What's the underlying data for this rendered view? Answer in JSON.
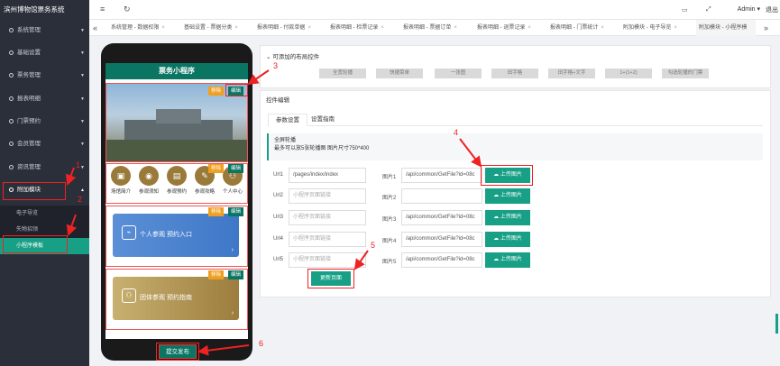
{
  "app": {
    "title": "滨州博物馆票务系统"
  },
  "sidebar": {
    "items": [
      {
        "label": "系统管理",
        "caret": "▼"
      },
      {
        "label": "基础设置",
        "caret": "▼"
      },
      {
        "label": "票务管理",
        "caret": "▼"
      },
      {
        "label": "报表明细",
        "caret": "▼"
      },
      {
        "label": "门票预约",
        "caret": "▼"
      },
      {
        "label": "会员管理",
        "caret": "▼"
      },
      {
        "label": "资讯管理",
        "caret": "▼"
      },
      {
        "label": "附加模块",
        "caret": "▲"
      }
    ],
    "subitems": [
      {
        "label": "电子导览"
      },
      {
        "label": "失物招领"
      },
      {
        "label": "小程序模板"
      }
    ]
  },
  "topbar": {
    "menu_icon": "≡",
    "refresh_icon": "↻",
    "user": "Admin",
    "user_caret": "▾",
    "logout": "退出",
    "icons": [
      "chat-icon",
      "fullscreen-icon"
    ]
  },
  "tabs": [
    {
      "label": "系统管理 - 数据权限"
    },
    {
      "label": "基础设置 - 票据分类"
    },
    {
      "label": "报表明细 - 付款单据"
    },
    {
      "label": "报表明细 - 检票记录"
    },
    {
      "label": "报表明细 - 票据订单"
    },
    {
      "label": "报表明细 - 退票记录"
    },
    {
      "label": "报表明细 - 门票统计"
    },
    {
      "label": "附加模块 - 电子导览"
    },
    {
      "label": "附加模块 - 小程序模"
    }
  ],
  "phone": {
    "title": "票务小程序",
    "remove_label": "移除",
    "edit_label": "编辑",
    "quick_items": [
      {
        "label": "场馆简介",
        "icon": "▣"
      },
      {
        "label": "参观须知",
        "icon": "◉"
      },
      {
        "label": "参观预约",
        "icon": "▤"
      },
      {
        "label": "参观攻略",
        "icon": "✎"
      },
      {
        "label": "个人中心",
        "icon": "⚇"
      }
    ],
    "entry_personal": "个人参观 预约入口",
    "entry_group": "团体参观 预约指南",
    "submit_label": "提交发布"
  },
  "layout_panel": {
    "header": "可添加的布局控件",
    "buttons": [
      "全宽轮播",
      "快捷菜单",
      "一张图",
      "田字格",
      "田字格+文字",
      "1+(1+2)",
      "勾选轮播的门票"
    ]
  },
  "control_panel": {
    "header": "控件编辑",
    "tabs": [
      "参数设置",
      "设置指南"
    ],
    "note_title": "全屏轮播",
    "note_text": "最多可以放5张轮播图 图片尺寸750*400",
    "rows": [
      {
        "url_label": "Url1",
        "url_value": "/pages/index/index",
        "img_label": "图片1",
        "img_value": "/api/common/GetFile?id=08c",
        "upload": "上传图片"
      },
      {
        "url_label": "Url2",
        "url_value": "",
        "img_label": "图片2",
        "img_value": "",
        "upload": "上传图片"
      },
      {
        "url_label": "Url3",
        "url_value": "",
        "img_label": "图片3",
        "img_value": "/api/common/GetFile?id=08c",
        "upload": "上传图片"
      },
      {
        "url_label": "Url4",
        "url_value": "",
        "img_label": "图片4",
        "img_value": "/api/common/GetFile?id=08c",
        "upload": "上传图片"
      },
      {
        "url_label": "Url5",
        "url_value": "",
        "img_label": "图片5",
        "img_value": "/api/common/GetFile?id=08c",
        "upload": "上传图片"
      }
    ],
    "url_placeholder": "小程序页面链接",
    "update_label": "更新页面"
  },
  "annotations": [
    "1",
    "2",
    "3",
    "4",
    "5",
    "6"
  ],
  "colors": {
    "accent": "#17a085",
    "sidebar": "#2b2f3a",
    "marker": "#e22"
  }
}
